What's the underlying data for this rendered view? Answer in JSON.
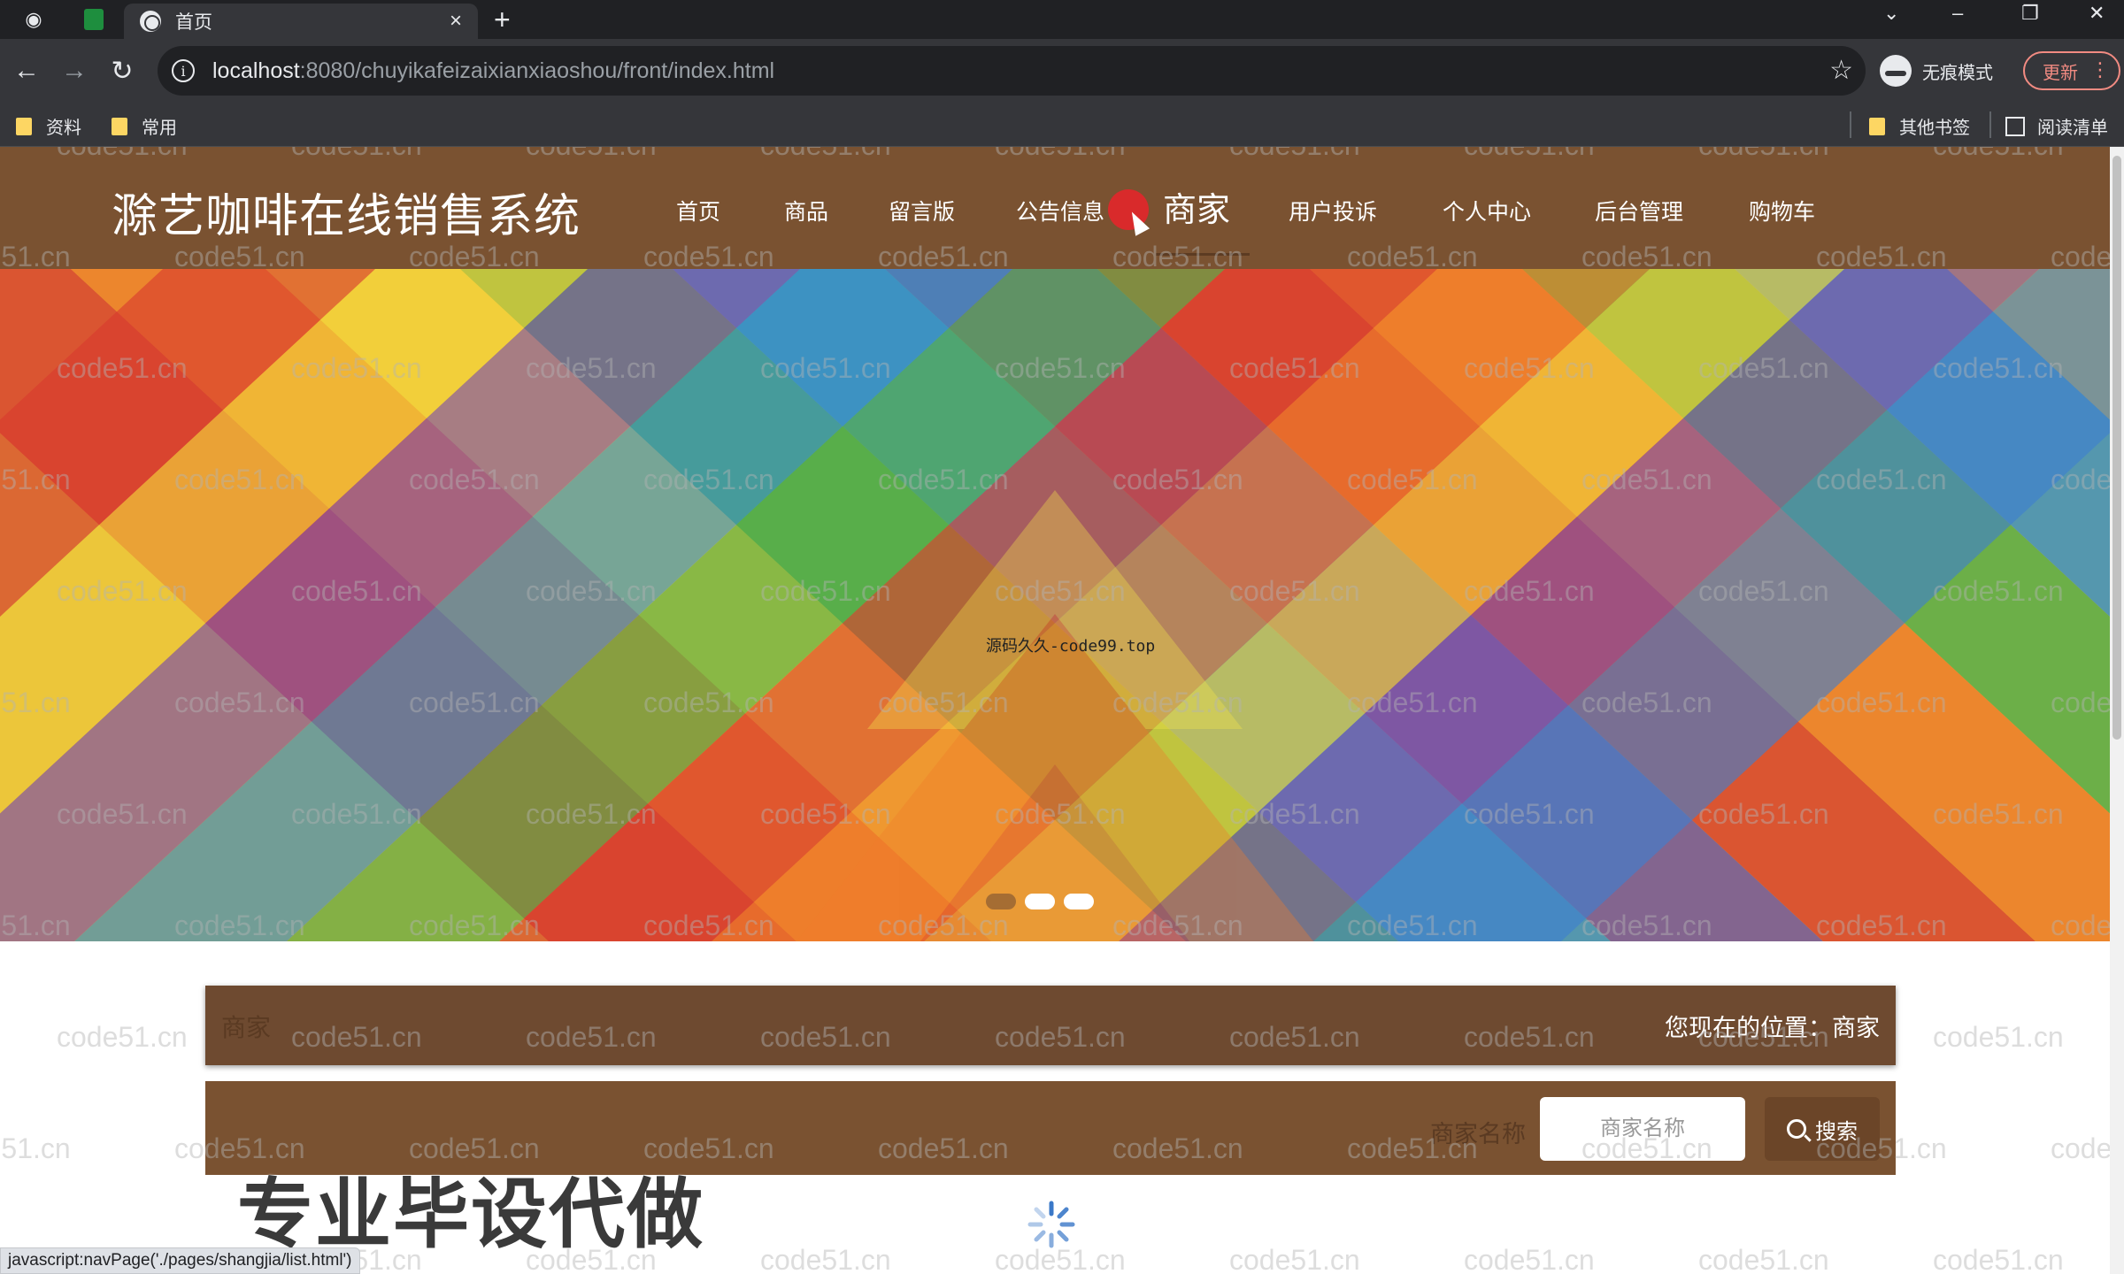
{
  "browser": {
    "tab_title": "首页",
    "tab_close": "×",
    "new_tab": "+",
    "url_host": "localhost",
    "url_rest": ":8080/chuyikafeizaixianxiaoshou/front/index.html",
    "incognito_label": "无痕模式",
    "update_label": "更新",
    "bookmarks": [
      {
        "label": "资料"
      },
      {
        "label": "常用"
      }
    ],
    "other_bookmarks": "其他书签",
    "reading_list": "阅读清单",
    "status_url": "javascript:navPage('./pages/shangjia/list.html')"
  },
  "site": {
    "title": "滁艺咖啡在线销售系统",
    "nav": [
      {
        "label": "首页"
      },
      {
        "label": "商品"
      },
      {
        "label": "留言版"
      },
      {
        "label": "公告信息"
      },
      {
        "label": "商家",
        "active": true
      },
      {
        "label": "用户投诉"
      },
      {
        "label": "个人中心"
      },
      {
        "label": "后台管理"
      },
      {
        "label": "购物车"
      }
    ],
    "banner_caption": "源码久久-code99.top",
    "carousel_count": 3
  },
  "content": {
    "section_title": "商家",
    "location_text": "您现在的位置：商家",
    "search_label": "商家名称",
    "search_placeholder": "商家名称",
    "search_button": "搜索"
  },
  "overlay": {
    "promo": "专业毕设代做",
    "watermark": "code51.cn"
  },
  "colors": {
    "header_brown": "#7a5231",
    "crumb_brown": "#6e4a30",
    "cursor_red": "#e3262b"
  }
}
